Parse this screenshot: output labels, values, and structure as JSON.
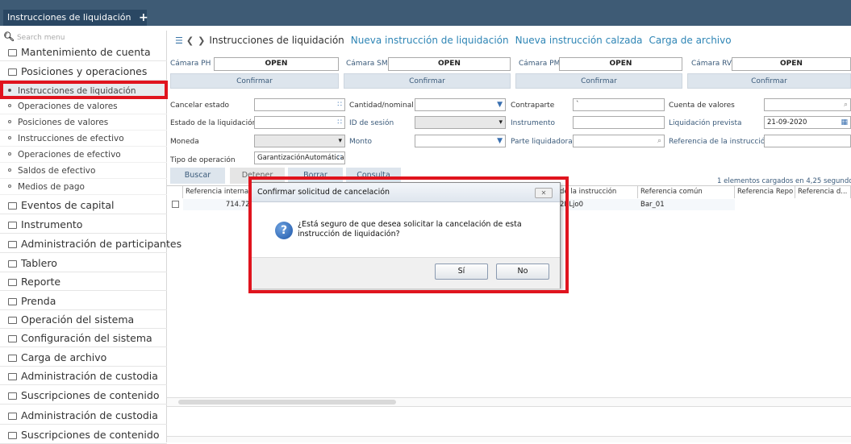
{
  "tab": {
    "label": "Instrucciones de liquidación",
    "plus": "+"
  },
  "sidebar": {
    "search_placeholder": "Search menu",
    "items": [
      {
        "label": "Mantenimiento de cuenta",
        "type": "folder"
      },
      {
        "label": "Posiciones y operaciones",
        "type": "folder-open"
      },
      {
        "label": "Instrucciones de liquidación",
        "type": "sub",
        "active": true
      },
      {
        "label": "Operaciones de valores",
        "type": "sub"
      },
      {
        "label": "Posiciones de valores",
        "type": "sub"
      },
      {
        "label": "Instrucciones de efectivo",
        "type": "sub"
      },
      {
        "label": "Operaciones de efectivo",
        "type": "sub"
      },
      {
        "label": "Saldos de efectivo",
        "type": "sub"
      },
      {
        "label": "Medios de pago",
        "type": "sub"
      },
      {
        "label": "Eventos de capital",
        "type": "folder"
      },
      {
        "label": "Instrumento",
        "type": "folder"
      },
      {
        "label": "Administración de participantes",
        "type": "folder"
      },
      {
        "label": "Tablero",
        "type": "folder"
      },
      {
        "label": "Reporte",
        "type": "folder"
      },
      {
        "label": "Prenda",
        "type": "folder"
      },
      {
        "label": "Operación del sistema",
        "type": "folder"
      },
      {
        "label": "Configuración del sistema",
        "type": "folder"
      },
      {
        "label": "Carga de archivo",
        "type": "folder"
      },
      {
        "label": "Administración de custodia",
        "type": "folder"
      },
      {
        "label": "Suscripciones de contenido",
        "type": "folder"
      },
      {
        "label": "Administración de custodia",
        "type": "folder"
      },
      {
        "label": "Suscripciones de contenido",
        "type": "folder"
      }
    ]
  },
  "header": {
    "current": "Instrucciones de liquidación",
    "links": [
      "Nueva instrucción de liquidación",
      "Nueva instrucción calzada",
      "Carga de archivo"
    ]
  },
  "camaras": [
    {
      "label": "Cámara PH",
      "value": "OPEN",
      "confirm": "Confirmar"
    },
    {
      "label": "Cámara SM",
      "value": "OPEN",
      "confirm": "Confirmar"
    },
    {
      "label": "Cámara PM",
      "value": "OPEN",
      "confirm": "Confirmar"
    },
    {
      "label": "Cámara RV",
      "value": "OPEN",
      "confirm": "Confirmar"
    }
  ],
  "filters": {
    "cancelar_estado": "Cancelar estado",
    "estado_liquidacion": "Estado de la liquidación",
    "moneda": "Moneda",
    "tipo_operacion": "Tipo de operación",
    "tipo_operacion_value": "GarantizaciónAutomática",
    "cantidad_nominal": "Cantidad/nominal",
    "id_sesion": "ID de sesión",
    "monto": "Monto",
    "contraparte": "Contraparte",
    "contraparte_value": "`",
    "instrumento": "Instrumento",
    "parte_liquidadora": "Parte liquidadora",
    "cuenta_valores": "Cuenta de valores",
    "liquidacion_prevista": "Liquidación prevista",
    "liquidacion_prevista_value": "21-09-2020",
    "referencia_instruccion": "Referencia de la instrucción"
  },
  "actions": {
    "buscar": "Buscar",
    "detener": "Detener",
    "borrar": "Borrar",
    "consulta": "Consulta"
  },
  "grid": {
    "status": "1 elementos cargados en 4,25 segundo",
    "headers": [
      "Referencia interna",
      "de la instrucción",
      "Referencia común",
      "Referencia Repo",
      "Referencia d..."
    ],
    "row": {
      "ref_interna": "714.726",
      "ref_instruccion": "2RLjo0",
      "ref_comun": "Bar_01"
    }
  },
  "dialog": {
    "title": "Confirmar solicitud de cancelación",
    "message": "¿Está seguro de que desea solicitar la cancelación de esta instrucción de liquidación?",
    "yes": "Sí",
    "no": "No",
    "close": "✕"
  },
  "colors": {
    "highlight": "#e0141e",
    "topbar": "#3e5b75",
    "link": "#2e85b5"
  }
}
